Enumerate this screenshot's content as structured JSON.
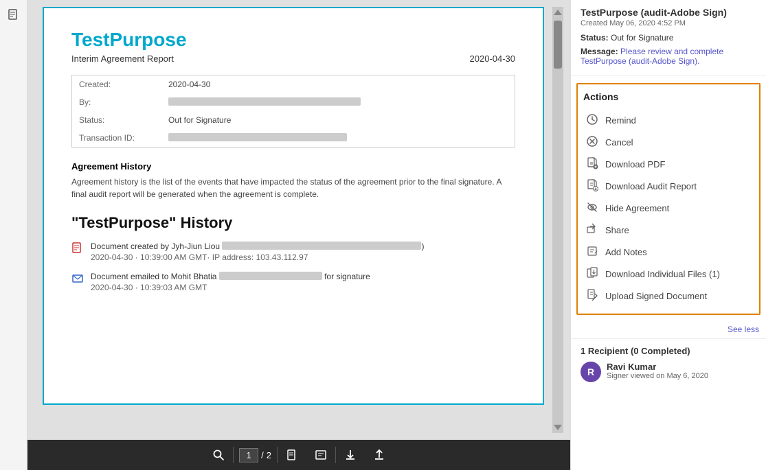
{
  "leftbar": {
    "icon": "📄"
  },
  "document": {
    "title": "TestPurpose",
    "subtitle": "Interim Agreement Report",
    "date": "2020-04-30",
    "info_table": {
      "rows": [
        {
          "label": "Created:",
          "value": "2020-04-30",
          "blurred": false
        },
        {
          "label": "By:",
          "value": "BLURRED_LONG",
          "blurred": true
        },
        {
          "label": "Status:",
          "value": "Out for Signature",
          "blurred": false
        },
        {
          "label": "Transaction ID:",
          "value": "BLURRED_LONG_ID",
          "blurred": true
        }
      ]
    },
    "agreement_history": {
      "title": "Agreement History",
      "description": "Agreement history is the list of the events that have impacted the status of the agreement prior to the final signature. A final audit report will be generated when the agreement is complete."
    },
    "history_title": "\"TestPurpose\" History",
    "history_items": [
      {
        "text": "Document created by Jyh-Jiun Liou",
        "blurred_part": "BLURRED",
        "timestamp": "2020-04-30 · 10:39:00 AM GMT· IP address: 103.43.112.97",
        "icon_type": "document-red"
      },
      {
        "text": "Document emailed to Mohit Bhatia",
        "blurred_part": "BLURRED_EMAIL",
        "suffix": " for signature",
        "timestamp": "2020-04-30 · 10:39:03 AM GMT",
        "icon_type": "email-blue"
      }
    ]
  },
  "toolbar": {
    "search_label": "🔍",
    "page_current": "1",
    "page_total": "2",
    "icon1": "📄",
    "icon2": "🖼",
    "icon3": "⬇",
    "icon4": "⬆"
  },
  "right_panel": {
    "doc_title": "TestPurpose (audit-Adobe Sign)",
    "created": "Created May 06, 2020 4:52 PM",
    "status_label": "Status:",
    "status_value": "Out for Signature",
    "message_label": "Message:",
    "message_text": "Please review and complete TestPurpose (audit-Adobe Sign).",
    "actions_title": "Actions",
    "actions": [
      {
        "label": "Remind",
        "icon": "clock"
      },
      {
        "label": "Cancel",
        "icon": "x-circle"
      },
      {
        "label": "Download PDF",
        "icon": "download-pdf"
      },
      {
        "label": "Download Audit Report",
        "icon": "download-audit"
      },
      {
        "label": "Hide Agreement",
        "icon": "eye-slash"
      },
      {
        "label": "Share",
        "icon": "share"
      },
      {
        "label": "Add Notes",
        "icon": "notes"
      },
      {
        "label": "Download Individual Files (1)",
        "icon": "download-files"
      },
      {
        "label": "Upload Signed Document",
        "icon": "upload"
      }
    ],
    "see_less": "See less",
    "recipients_title": "1 Recipient (0 Completed)",
    "recipient": {
      "initials": "R",
      "name": "Ravi Kumar",
      "status": "Signer viewed on May 6, 2020"
    }
  }
}
